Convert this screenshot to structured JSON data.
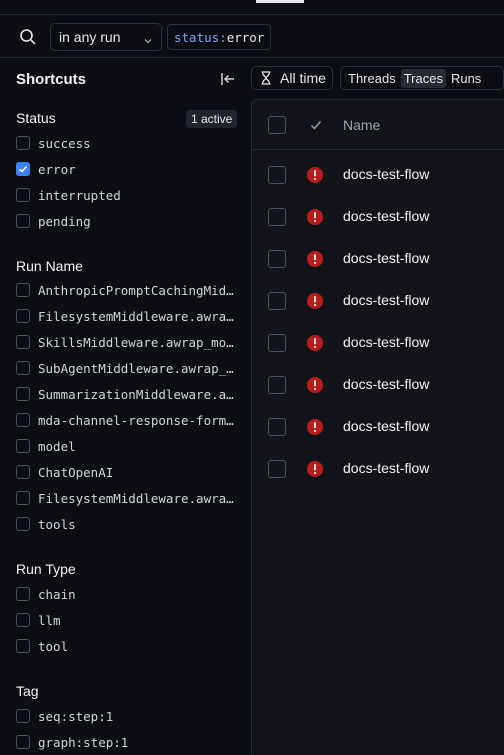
{
  "search": {
    "scope": "in any run",
    "filter_key": "status",
    "filter_sep": ":",
    "filter_value": "error"
  },
  "sidebar": {
    "title": "Shortcuts",
    "status": {
      "title": "Status",
      "badge": "1 active",
      "options": [
        {
          "label": "success",
          "checked": false
        },
        {
          "label": "error",
          "checked": true
        },
        {
          "label": "interrupted",
          "checked": false
        },
        {
          "label": "pending",
          "checked": false
        }
      ]
    },
    "run_name": {
      "title": "Run Name",
      "options": [
        {
          "label": "AnthropicPromptCachingMiddleware.awrap_model_call",
          "checked": false
        },
        {
          "label": "FilesystemMiddleware.awrap_model_call",
          "checked": false
        },
        {
          "label": "SkillsMiddleware.awrap_model_call",
          "checked": false
        },
        {
          "label": "SubAgentMiddleware.awrap_model_call",
          "checked": false
        },
        {
          "label": "SummarizationMiddleware.awrap_model_call",
          "checked": false
        },
        {
          "label": "mda-channel-response-formatter",
          "checked": false
        },
        {
          "label": "model",
          "checked": false
        },
        {
          "label": "ChatOpenAI",
          "checked": false
        },
        {
          "label": "FilesystemMiddleware.awrap_tool_call",
          "checked": false
        },
        {
          "label": "tools",
          "checked": false
        }
      ]
    },
    "run_type": {
      "title": "Run Type",
      "options": [
        {
          "label": "chain",
          "checked": false
        },
        {
          "label": "llm",
          "checked": false
        },
        {
          "label": "tool",
          "checked": false
        }
      ]
    },
    "tag": {
      "title": "Tag",
      "options": [
        {
          "label": "seq:step:1",
          "checked": false
        },
        {
          "label": "graph:step:1",
          "checked": false
        }
      ]
    }
  },
  "toolbar": {
    "time_label": "All time",
    "tabs": [
      {
        "label": "Threads",
        "active": false
      },
      {
        "label": "Traces",
        "active": true
      },
      {
        "label": "Runs",
        "active": false
      }
    ]
  },
  "table": {
    "name_header": "Name",
    "rows": [
      {
        "name": "docs-test-flow",
        "status": "error"
      },
      {
        "name": "docs-test-flow",
        "status": "error"
      },
      {
        "name": "docs-test-flow",
        "status": "error"
      },
      {
        "name": "docs-test-flow",
        "status": "error"
      },
      {
        "name": "docs-test-flow",
        "status": "error"
      },
      {
        "name": "docs-test-flow",
        "status": "error"
      },
      {
        "name": "docs-test-flow",
        "status": "error"
      },
      {
        "name": "docs-test-flow",
        "status": "error"
      }
    ]
  },
  "colors": {
    "background": "#0c0e13",
    "panel": "#121419",
    "accent": "#3b82f6",
    "error": "#b91c1c",
    "filter_key": "#7aa2f7"
  }
}
